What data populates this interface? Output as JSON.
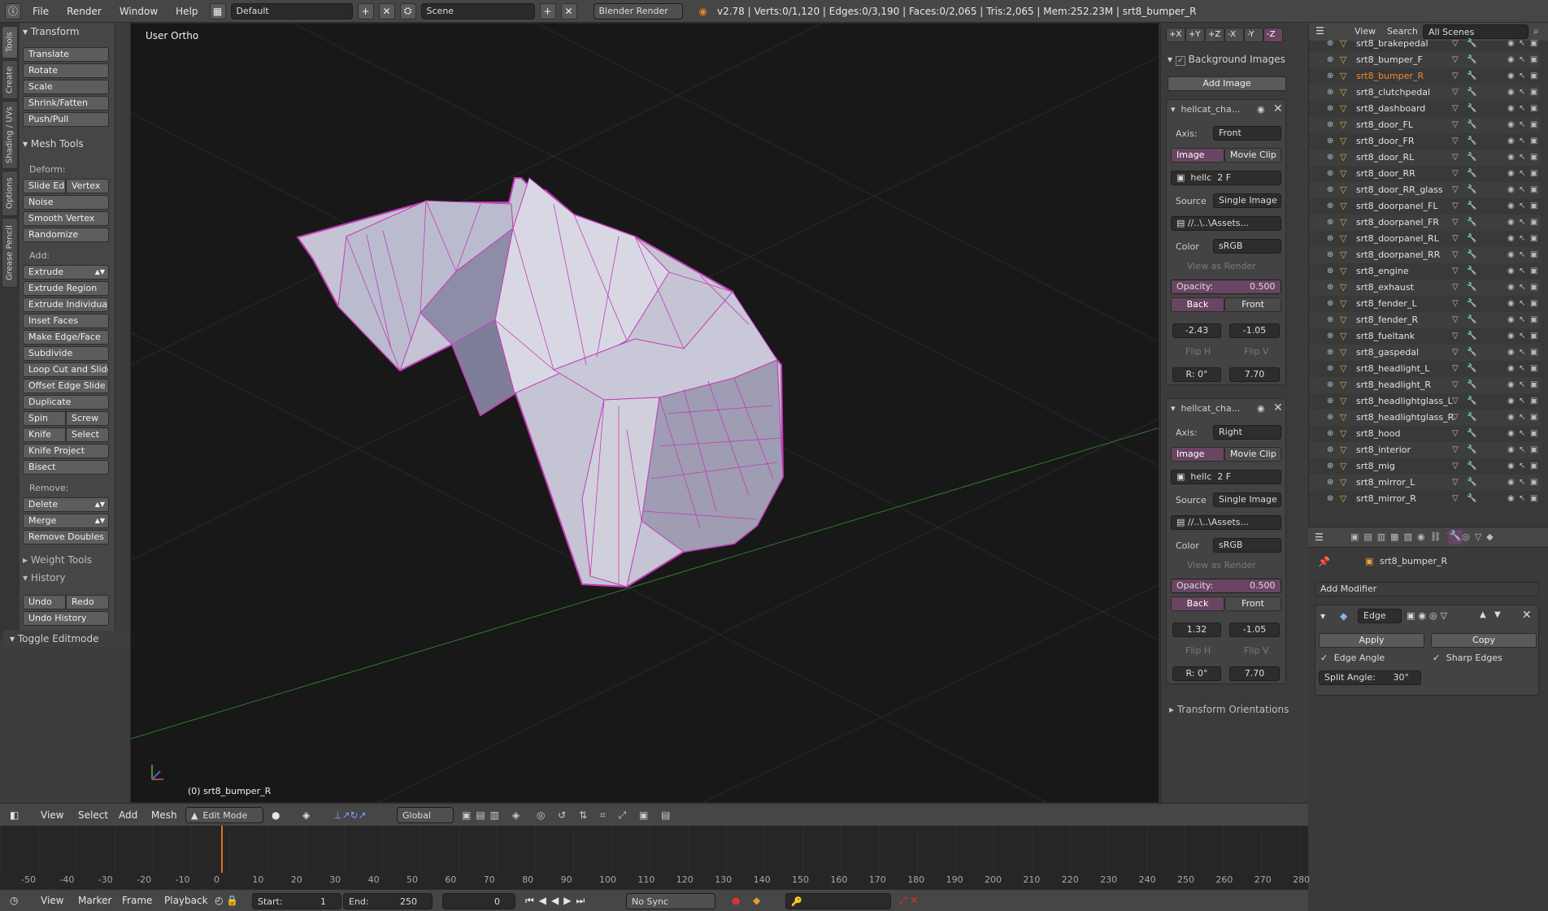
{
  "topbar": {
    "menus": [
      "File",
      "Render",
      "Window",
      "Help"
    ],
    "layout": "Default",
    "scene": "Scene",
    "engine": "Blender Render",
    "stats": "v2.78 | Verts:0/1,120 | Edges:0/3,190 | Faces:0/2,065 | Tris:2,065 | Mem:252.23M | srt8_bumper_R"
  },
  "tabs": [
    "Tools",
    "Create",
    "Shading / UVs",
    "Options",
    "Grease Pencil"
  ],
  "toolshelf": {
    "transform_header": "Transform",
    "transform": [
      "Translate",
      "Rotate",
      "Scale",
      "Shrink/Fatten",
      "Push/Pull"
    ],
    "mesh_tools_header": "Mesh Tools",
    "deform_label": "Deform:",
    "slide_edge": "Slide Ed",
    "vertex": "Vertex",
    "noise": "Noise",
    "smooth_vertex": "Smooth Vertex",
    "randomize": "Randomize",
    "add_label": "Add:",
    "extrude": "Extrude",
    "add_items": [
      "Extrude Region",
      "Extrude Individual",
      "Inset Faces",
      "Make Edge/Face",
      "Subdivide",
      "Loop Cut and Slide",
      "Offset Edge Slide",
      "Duplicate"
    ],
    "spin": "Spin",
    "screw": "Screw",
    "knife": "Knife",
    "select": "Select",
    "knife_project": "Knife Project",
    "bisect": "Bisect",
    "remove_label": "Remove:",
    "delete": "Delete",
    "merge": "Merge",
    "remove_doubles": "Remove Doubles",
    "weight_tools": "Weight Tools",
    "history": "History",
    "undo": "Undo",
    "redo": "Redo",
    "undo_history": "Undo History",
    "toggle_editmode": "Toggle Editmode"
  },
  "viewport": {
    "label": "User Ortho",
    "object_label": "(0) srt8_bumper_R",
    "colors": {
      "background": "#181818",
      "mesh_face": "#c5c4d4",
      "mesh_edge": "#c43ab8",
      "x_axis": "#7f2a2a",
      "y_axis": "#2f7a2f"
    }
  },
  "npanel": {
    "axis_buttons": [
      "+X",
      "+Y",
      "+Z",
      "-X",
      "-Y",
      "-Z"
    ],
    "bg_header": "Background Images",
    "add_image": "Add Image",
    "images": [
      {
        "name": "hellcat_cha...",
        "axis_label": "Axis:",
        "axis": "Front",
        "tab_image": "Image",
        "tab_clip": "Movie Clip",
        "file": "hellc",
        "users": "2",
        "fake": "F",
        "source_label": "Source",
        "source": "Single Image",
        "path": "//..\\..\\Assets...",
        "color_label": "Color",
        "color": "sRGB",
        "view_as_render": "View as Render",
        "opacity_label": "Opacity:",
        "opacity": "0.500",
        "back": "Back",
        "front": "Front",
        "x": "-2.43",
        "y": "-1.05",
        "flip_h": "Flip H",
        "flip_v": "Flip V",
        "rot": "R: 0°",
        "size": "7.70"
      },
      {
        "name": "hellcat_cha...",
        "axis_label": "Axis:",
        "axis": "Right",
        "tab_image": "Image",
        "tab_clip": "Movie Clip",
        "file": "hellc",
        "users": "2",
        "fake": "F",
        "source_label": "Source",
        "source": "Single Image",
        "path": "//..\\..\\Assets...",
        "color_label": "Color",
        "color": "sRGB",
        "view_as_render": "View as Render",
        "opacity_label": "Opacity:",
        "opacity": "0.500",
        "back": "Back",
        "front": "Front",
        "x": "1.32",
        "y": "-1.05",
        "flip_h": "Flip H",
        "flip_v": "Flip V",
        "rot": "R: 0°",
        "size": "7.70"
      }
    ],
    "transform_orientations": "Transform Orientations"
  },
  "outliner": {
    "view": "View",
    "search": "Search",
    "scenes": "All Scenes",
    "items": [
      "srt8_brakepedal",
      "srt8_bumper_F",
      "srt8_bumper_R",
      "srt8_clutchpedal",
      "srt8_dashboard",
      "srt8_door_FL",
      "srt8_door_FR",
      "srt8_door_RL",
      "srt8_door_RR",
      "srt8_door_RR_glass",
      "srt8_doorpanel_FL",
      "srt8_doorpanel_FR",
      "srt8_doorpanel_RL",
      "srt8_doorpanel_RR",
      "srt8_engine",
      "srt8_exhaust",
      "srt8_fender_L",
      "srt8_fender_R",
      "srt8_fueltank",
      "srt8_gaspedal",
      "srt8_headlight_L",
      "srt8_headlight_R",
      "srt8_headlightglass_L",
      "srt8_headlightglass_R",
      "srt8_hood",
      "srt8_interior",
      "srt8_mig",
      "srt8_mirror_L",
      "srt8_mirror_R"
    ],
    "active": "srt8_bumper_R"
  },
  "properties": {
    "object": "srt8_bumper_R",
    "add_modifier": "Add Modifier",
    "modifier_name": "Edge",
    "apply": "Apply",
    "copy": "Copy",
    "edge_angle": "Edge Angle",
    "sharp_edges": "Sharp Edges",
    "split_angle": "Split Angle:",
    "split_angle_value": "30°"
  },
  "viewheader": {
    "menus": [
      "View",
      "Select",
      "Add",
      "Mesh"
    ],
    "mode": "Edit Mode",
    "orientation": "Global"
  },
  "timeline": {
    "ticks": [
      "-50",
      "-40",
      "-30",
      "-20",
      "-10",
      "0",
      "10",
      "20",
      "30",
      "40",
      "50",
      "60",
      "70",
      "80",
      "90",
      "100",
      "110",
      "120",
      "130",
      "140",
      "150",
      "160",
      "170",
      "180",
      "190",
      "200",
      "210",
      "220",
      "230",
      "240",
      "250",
      "260",
      "270",
      "280"
    ],
    "current_frame": 0
  },
  "tlheader": {
    "menus": [
      "View",
      "Marker",
      "Frame",
      "Playback"
    ],
    "start_label": "Start:",
    "start": "1",
    "end_label": "End:",
    "end": "250",
    "current": "0",
    "sync": "No Sync"
  }
}
